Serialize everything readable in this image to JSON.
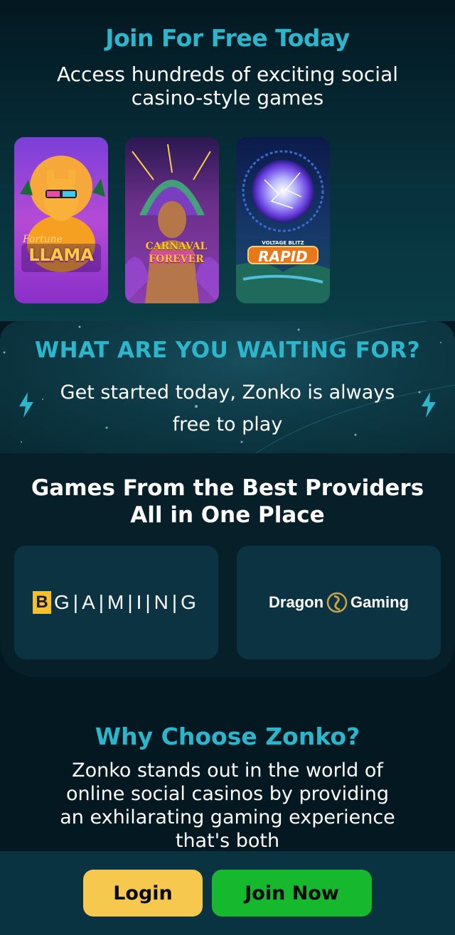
{
  "hero": {
    "title": "Join For Free Today",
    "subtitle": "Access hundreds of exciting social casino-style games",
    "games": [
      {
        "name": "Fortune Llama",
        "logo_line1": "Fortune",
        "logo_line2": "LLAMA"
      },
      {
        "name": "Carnaval Forever",
        "logo_line1": "CARNAVAL",
        "logo_line2": "FOREVER"
      },
      {
        "name": "Voltage Blitz Rapid",
        "logo_line1": "VOLTAGE BLITZ",
        "logo_line2": "RAPID"
      }
    ]
  },
  "cta": {
    "title": "WHAT ARE YOU WAITING FOR?",
    "subtitle": "Get started today, Zonko is always free to play"
  },
  "providers": {
    "title": "Games From the Best Providers All in One Place",
    "items": [
      {
        "name": "BGAMING",
        "b": "B",
        "rest": "G|A|M|I|N|G"
      },
      {
        "name": "Dragon Gaming",
        "left": "Dragon",
        "right": "Gaming"
      }
    ]
  },
  "why": {
    "title": "Why Choose Zonko?",
    "body": "Zonko stands out in the world of online social casinos by providing an exhilarating gaming experience that's both"
  },
  "buttons": {
    "login": "Login",
    "join": "Join Now"
  },
  "colors": {
    "accent": "#2bb6cc",
    "login": "#f6c94e",
    "join": "#16b82e"
  }
}
